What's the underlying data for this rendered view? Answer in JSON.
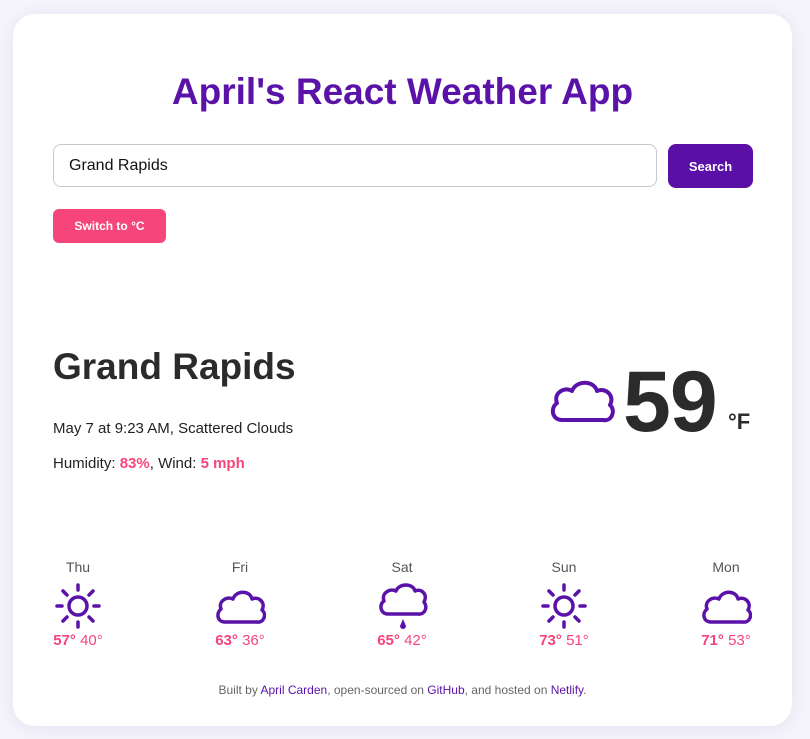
{
  "app": {
    "title": "April's React Weather App"
  },
  "search": {
    "value": "Grand Rapids",
    "placeholder": "",
    "button_label": "Search"
  },
  "unit_toggle": {
    "label": "Switch to °C"
  },
  "current": {
    "city": "Grand Rapids",
    "date_time": "May 7 at 9:23 AM",
    "description": "Scattered Clouds",
    "humidity_label": "Humidity: ",
    "humidity": "83%",
    "wind_label": "Wind: ",
    "wind": "5 mph",
    "temperature": "59",
    "unit": "°F",
    "icon": "cloud-icon"
  },
  "forecast": [
    {
      "day": "Thu",
      "high": "57°",
      "low": "40°",
      "icon": "sun-icon"
    },
    {
      "day": "Fri",
      "high": "63°",
      "low": "36°",
      "icon": "cloud-icon"
    },
    {
      "day": "Sat",
      "high": "65°",
      "low": "42°",
      "icon": "rain-cloud-icon"
    },
    {
      "day": "Sun",
      "high": "73°",
      "low": "51°",
      "icon": "sun-icon"
    },
    {
      "day": "Mon",
      "high": "71°",
      "low": "53°",
      "icon": "cloud-icon"
    }
  ],
  "footer": {
    "prefix": "Built by ",
    "author": "April Carden",
    "middle": ", open-sourced on ",
    "repo": "GitHub",
    "middle2": ", and hosted on ",
    "host": "Netlify",
    "suffix": "."
  },
  "colors": {
    "primary": "#5a12a8",
    "accent": "#f5457a",
    "text": "#2b2b2b"
  }
}
